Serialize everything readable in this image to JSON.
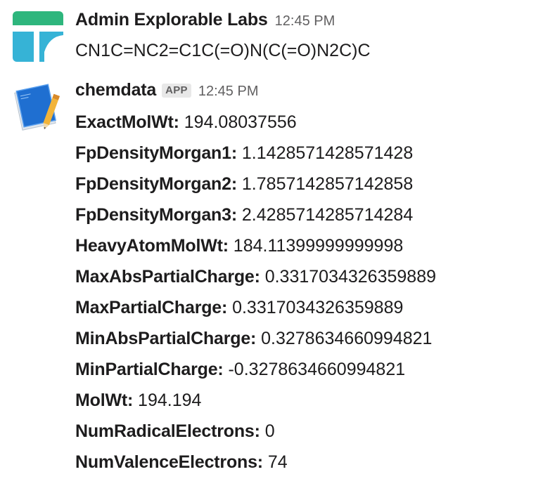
{
  "messages": [
    {
      "sender": "Admin Explorable Labs",
      "time": "12:45 PM",
      "text": "CN1C=NC2=C1C(=O)N(C(=O)N2C)C",
      "avatar_icon": "explorable-labs-logo-icon",
      "avatar_colors": {
        "green": "#2eb67d",
        "teal": "#36b3d6"
      }
    },
    {
      "sender": "chemdata",
      "badge": "APP",
      "time": "12:45 PM",
      "avatar_icon": "blueprint-pencil-icon",
      "properties": [
        {
          "key": "ExactMolWt:",
          "value": "194.08037556"
        },
        {
          "key": "FpDensityMorgan1:",
          "value": "1.1428571428571428"
        },
        {
          "key": "FpDensityMorgan2:",
          "value": "1.7857142857142858"
        },
        {
          "key": "FpDensityMorgan3:",
          "value": "2.4285714285714284"
        },
        {
          "key": "HeavyAtomMolWt:",
          "value": "184.11399999999998"
        },
        {
          "key": "MaxAbsPartialCharge:",
          "value": "0.3317034326359889"
        },
        {
          "key": "MaxPartialCharge:",
          "value": "0.3317034326359889"
        },
        {
          "key": "MinAbsPartialCharge:",
          "value": "0.3278634660994821"
        },
        {
          "key": "MinPartialCharge:",
          "value": "-0.3278634660994821"
        },
        {
          "key": "MolWt:",
          "value": "194.194"
        },
        {
          "key": "NumRadicalElectrons:",
          "value": "0"
        },
        {
          "key": "NumValenceElectrons:",
          "value": "74"
        }
      ]
    }
  ]
}
